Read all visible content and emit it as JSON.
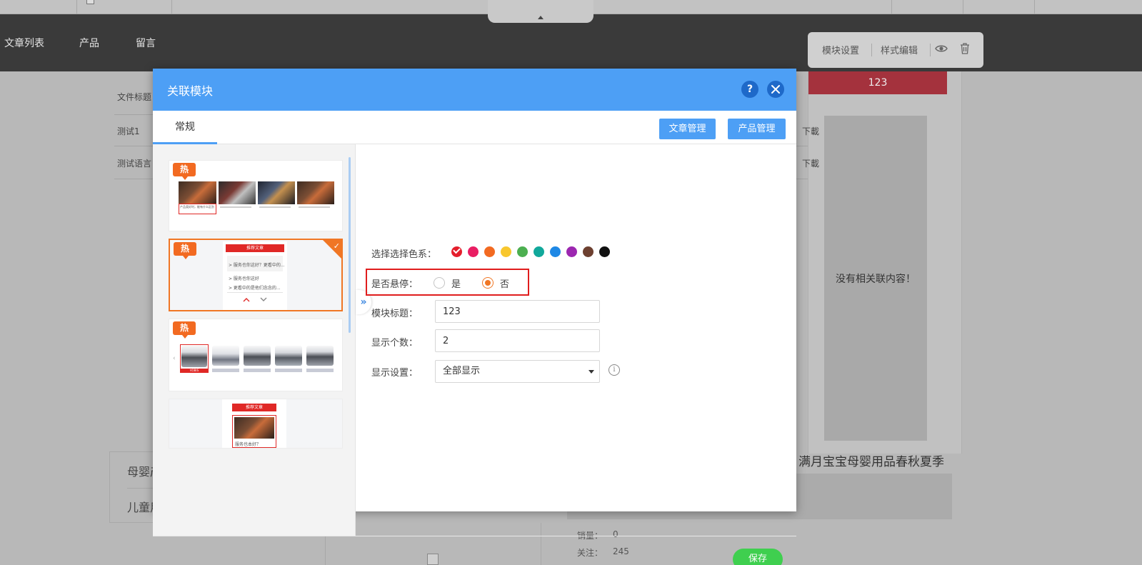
{
  "background": {
    "nav": {
      "items": [
        "文章列表",
        "产品",
        "留言"
      ]
    },
    "toolbar": {
      "module_settings": "模块设置",
      "style_edit": "样式编辑"
    },
    "side_panel": {
      "header": "123",
      "empty_text": "没有相关联内容！"
    },
    "list": {
      "col1": "文件标题",
      "row1": "测试1",
      "row2": "测试语言",
      "download": "下載"
    },
    "categories": [
      "母婴产",
      "儿童用"
    ],
    "product": {
      "title": "满月宝宝母婴用品春秋夏季",
      "sales_label": "销量：",
      "sales_value": "0",
      "follow_label": "关注：",
      "follow_value": "245"
    }
  },
  "modal": {
    "title": "关联模块",
    "help_icon": "?",
    "tabs": [
      {
        "label": "常规",
        "active": true
      }
    ],
    "buttons": {
      "article_mgmt": "文章管理",
      "product_mgmt": "产品管理",
      "save": "保存"
    },
    "templates": [
      {
        "badge": "热",
        "selected": false,
        "caption": "产品类好时，能有什么区别"
      },
      {
        "badge": "热",
        "selected": true,
        "header": "推荐文章",
        "lines": [
          "> 服务也你这好？更看中的...",
          "> 服务也你这好",
          "> 更看中的是他们念念的..."
        ]
      },
      {
        "badge": "热",
        "selected": false,
        "label": "VOBIS"
      },
      {
        "badge": "",
        "selected": false,
        "header": "推荐文章",
        "caption": "服务也本好？"
      }
    ],
    "collapse_icon": "»",
    "form": {
      "color_label": "选择选择色系：",
      "colors": [
        "#e41e2c",
        "#e91e63",
        "#f26a21",
        "#f8c72e",
        "#4caf50",
        "#11a89b",
        "#1e88e5",
        "#9c27b0",
        "#6d4030",
        "#111111"
      ],
      "selected_color_index": 0,
      "hover_label": "是否悬停：",
      "hover_options": [
        "是",
        "否"
      ],
      "hover_selected": "否",
      "title_label": "模块标题：",
      "title_value": "123",
      "count_label": "显示个数：",
      "count_value": "2",
      "display_label": "显示设置：",
      "display_value": "全部显示",
      "info_icon": "i"
    }
  }
}
